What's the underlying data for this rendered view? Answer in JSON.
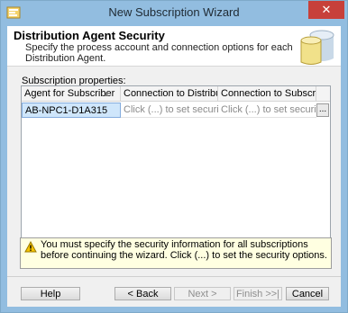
{
  "window": {
    "title": "New Subscription Wizard",
    "close_glyph": "✕"
  },
  "header": {
    "title": "Distribution Agent Security",
    "description": "Specify the process account and connection options for each Distribution Agent."
  },
  "subscription_properties": {
    "label": "Subscription properties:",
    "columns": [
      "Agent for Subscriber",
      "Connection to Distributor",
      "Connection to Subscriber"
    ],
    "sort_indicator": "▲",
    "rows": [
      {
        "agent": "AB-NPC1-D1A315",
        "distributor": "Click (...) to set securit...",
        "subscriber": "Click (...) to set security...",
        "ellipsis": "..."
      }
    ]
  },
  "warning": {
    "text": "You must specify the security information for all subscriptions before continuing the wizard. Click (...) to set the security options."
  },
  "buttons": {
    "help": "Help",
    "back": "< Back",
    "next": "Next >",
    "finish": "Finish >>|",
    "cancel": "Cancel"
  },
  "colors": {
    "titlebar": "#92bde0",
    "close": "#c7403a",
    "selection": "#cfe6fb",
    "warning_bg": "#ffffe1"
  },
  "icons": {
    "app": "sql-wizard-icon",
    "header": "database-cylinder-icon",
    "warning": "warning-triangle-icon"
  }
}
